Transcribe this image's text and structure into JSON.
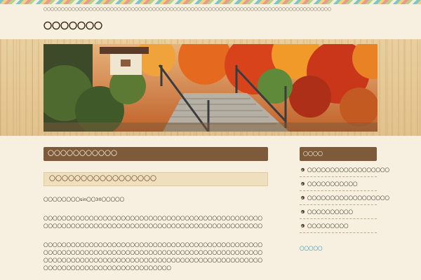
{
  "header": {
    "tagline": "〇〇〇〇〇〇〇〇〇〇〇〇〇〇〇〇〇〇〇〇〇〇〇〇〇〇〇〇〇〇〇〇〇〇〇〇〇〇〇〇〇〇〇〇〇〇〇〇〇〇〇〇〇〇〇〇〇〇〇〇〇〇〇〇〇〇〇〇〇〇〇〇〇〇〇〇〇〇〇〇〇〇",
    "site_title": "〇〇〇〇〇〇〇"
  },
  "main": {
    "section_title": "〇〇〇〇〇〇〇〇〇〇〇",
    "post_title": "〇〇〇〇〇〇〇〇〇〇〇〇〇〇〇〇〇",
    "paragraphs": [
      "〇〇〇〇〇〇〇〇sin〇〇30〇〇〇〇〇",
      "〇〇〇〇〇〇〇〇〇〇〇〇〇〇〇〇〇〇〇〇〇〇〇〇〇〇〇〇〇〇〇〇〇〇〇〇〇〇〇〇〇〇〇〇〇〇〇〇〇〇〇〇〇〇〇〇〇〇〇〇〇〇〇〇〇〇〇〇〇〇〇〇〇〇〇〇〇〇〇〇〇〇〇〇〇〇〇〇〇〇〇〇〇〇〇〇〇〇〇〇〇〇〇〇〇〇〇〇〇〇〇〇〇〇",
      "〇〇〇〇〇〇〇〇〇〇〇〇〇〇〇〇〇〇〇〇〇〇〇〇〇〇〇〇〇〇〇〇〇〇〇〇〇〇〇〇〇〇〇〇〇〇〇〇〇〇〇〇〇〇〇〇〇〇〇〇〇〇〇〇〇〇〇〇〇〇〇〇〇〇〇〇〇〇〇〇〇〇〇〇〇〇〇〇〇〇〇〇〇〇〇〇〇〇〇〇〇〇〇〇〇〇〇〇〇〇〇〇〇〇〇〇〇〇〇〇〇〇〇〇〇〇〇〇〇〇〇〇〇〇〇〇〇〇〇〇〇〇〇〇〇〇〇〇〇〇〇〇〇〇〇〇〇〇〇〇〇〇〇〇〇〇〇〇〇〇〇〇"
    ]
  },
  "sidebar": {
    "heading": "〇〇〇〇",
    "items": [
      {
        "label": "〇〇〇〇〇〇〇〇〇〇〇〇〇〇〇〇〇〇"
      },
      {
        "label": "〇〇〇〇〇〇〇〇〇〇〇"
      },
      {
        "label": "〇〇〇〇〇〇〇〇〇〇〇〇〇〇〇〇〇〇"
      },
      {
        "label": "〇〇〇〇〇〇〇〇〇〇"
      },
      {
        "label": "〇〇〇〇〇〇〇〇〇"
      }
    ],
    "link": "〇〇〇〇〇"
  },
  "colors": {
    "page_bg": "#f7efe0",
    "accent_brown": "#7c5a3a",
    "title_box": "#efdfbf",
    "link_blue": "#2f8fb0"
  },
  "images": {
    "header_photo": "autumn-garden-stone-steps"
  }
}
